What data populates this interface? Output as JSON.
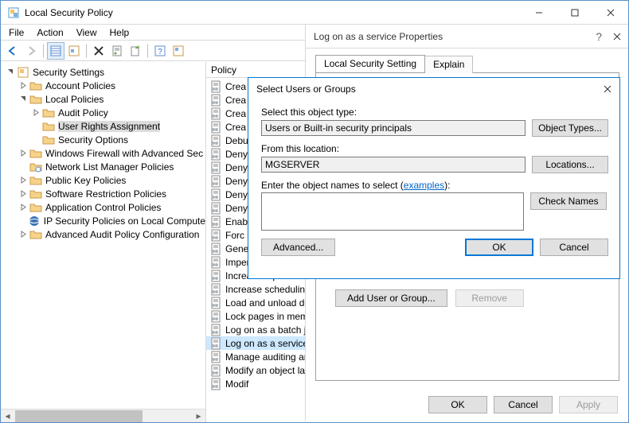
{
  "window": {
    "title": "Local Security Policy",
    "menu": [
      "File",
      "Action",
      "View",
      "Help"
    ]
  },
  "tree": [
    {
      "depth": 0,
      "exp": "open",
      "icon": "shield",
      "label": "Security Settings"
    },
    {
      "depth": 1,
      "exp": "closed",
      "icon": "folder",
      "label": "Account Policies"
    },
    {
      "depth": 1,
      "exp": "open",
      "icon": "folder",
      "label": "Local Policies"
    },
    {
      "depth": 2,
      "exp": "closed",
      "icon": "folder",
      "label": "Audit Policy"
    },
    {
      "depth": 2,
      "exp": "none",
      "icon": "folder",
      "label": "User Rights Assignment",
      "selected": true
    },
    {
      "depth": 2,
      "exp": "none",
      "icon": "folder",
      "label": "Security Options"
    },
    {
      "depth": 1,
      "exp": "closed",
      "icon": "folder",
      "label": "Windows Firewall with Advanced Sec"
    },
    {
      "depth": 1,
      "exp": "none",
      "icon": "netfolder",
      "label": "Network List Manager Policies"
    },
    {
      "depth": 1,
      "exp": "closed",
      "icon": "folder",
      "label": "Public Key Policies"
    },
    {
      "depth": 1,
      "exp": "closed",
      "icon": "folder",
      "label": "Software Restriction Policies"
    },
    {
      "depth": 1,
      "exp": "closed",
      "icon": "folder",
      "label": "Application Control Policies"
    },
    {
      "depth": 1,
      "exp": "none",
      "icon": "ipsec",
      "label": "IP Security Policies on Local Compute"
    },
    {
      "depth": 1,
      "exp": "closed",
      "icon": "folder",
      "label": "Advanced Audit Policy Configuration"
    }
  ],
  "list": {
    "header": "Policy",
    "items": [
      {
        "label": "Crea"
      },
      {
        "label": "Crea"
      },
      {
        "label": "Crea"
      },
      {
        "label": "Crea"
      },
      {
        "label": "Debu"
      },
      {
        "label": "Deny"
      },
      {
        "label": "Deny"
      },
      {
        "label": "Deny"
      },
      {
        "label": "Deny"
      },
      {
        "label": "Deny"
      },
      {
        "label": "Enab"
      },
      {
        "label": "Forc"
      },
      {
        "label": "Gene"
      },
      {
        "label": "Impersonate a client"
      },
      {
        "label": "Increase a process w"
      },
      {
        "label": "Increase scheduling"
      },
      {
        "label": "Load and unload dev"
      },
      {
        "label": "Lock pages in memo"
      },
      {
        "label": "Log on as a batch jo"
      },
      {
        "label": "Log on as a service",
        "selected": true
      },
      {
        "label": "Manage auditing an"
      },
      {
        "label": "Modify an object lab"
      },
      {
        "label": "Modif"
      }
    ]
  },
  "propdlg": {
    "title": "Log on as a service Properties",
    "tabs": {
      "active": "Local Security Setting",
      "inactive": "Explain"
    },
    "addusergroup": "Add User or Group...",
    "remove": "Remove",
    "ok": "OK",
    "cancel": "Cancel",
    "apply": "Apply"
  },
  "seldlg": {
    "title": "Select Users or Groups",
    "objtype_label": "Select this object type:",
    "objtype_value": "Users or Built-in security principals",
    "objtypes_btn": "Object Types...",
    "location_label": "From this location:",
    "location_value": "MGSERVER",
    "locations_btn": "Locations...",
    "names_label_pre": "Enter the object names to select (",
    "names_label_link": "examples",
    "names_label_post": "):",
    "checknames": "Check Names",
    "advanced": "Advanced...",
    "ok": "OK",
    "cancel": "Cancel"
  }
}
